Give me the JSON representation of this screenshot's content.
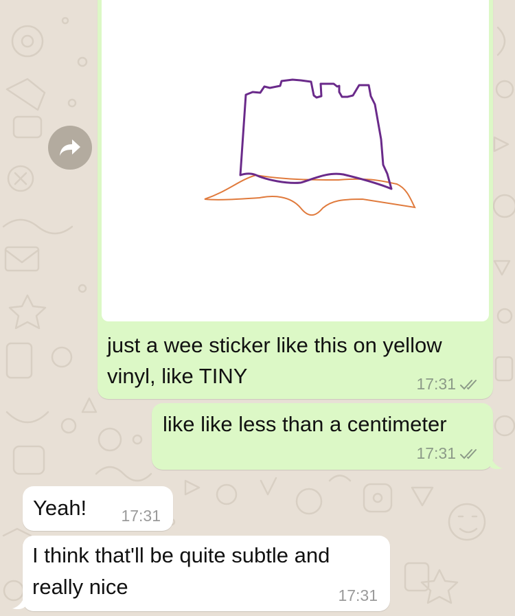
{
  "chat": {
    "messages": [
      {
        "direction": "outgoing",
        "type": "image",
        "image_icon": "sandcastle-sticker-drawing",
        "caption": "just a wee sticker like this on yellow vinyl, like TINY",
        "caption_line1": "just a wee sticker like this on yellow",
        "caption_line2": "vinyl, like TINY",
        "time": "17:31",
        "status": "read"
      },
      {
        "direction": "outgoing",
        "type": "text",
        "text": "like like less than a centimeter",
        "time": "17:31",
        "status": "read"
      },
      {
        "direction": "incoming",
        "type": "text",
        "text": "Yeah!",
        "time": "17:31"
      },
      {
        "direction": "incoming",
        "type": "text",
        "text": "I think that'll be quite subtle and really nice",
        "text_line1": "I think that'll be quite subtle and",
        "text_line2": "really nice",
        "time": "17:31"
      }
    ],
    "forward_icon": "forward-arrow-icon"
  },
  "colors": {
    "outgoing_bubble": "#dcf8c6",
    "incoming_bubble": "#ffffff",
    "wallpaper": "#e8e0d6",
    "castle_stroke": "#6a2a8a",
    "sand_stroke": "#e07a3c",
    "read_ticks": "#8c9a88"
  }
}
